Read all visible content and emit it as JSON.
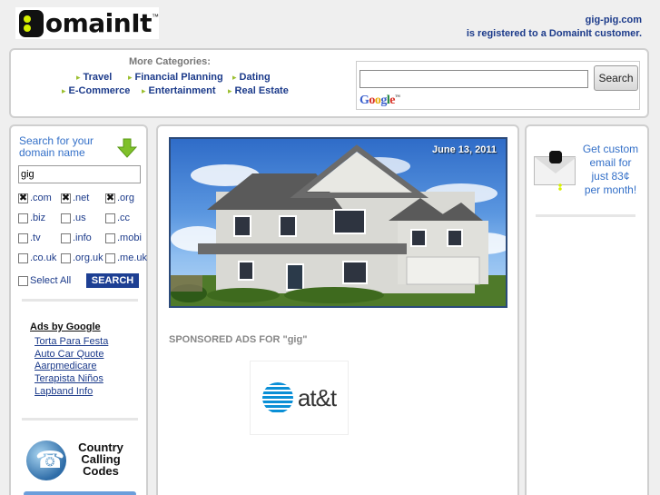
{
  "header": {
    "logo_text": "omainIt",
    "logo_tm": "™",
    "domain": "gig-pig.com",
    "registered_text": "is registered to a DomainIt customer."
  },
  "categories": {
    "title": "More Categories:",
    "items": [
      {
        "label": "Travel"
      },
      {
        "label": "Financial Planning"
      },
      {
        "label": "Dating"
      },
      {
        "label": "E-Commerce"
      },
      {
        "label": "Entertainment"
      },
      {
        "label": "Real Estate"
      }
    ],
    "accent_color": "#9bbf2e"
  },
  "google_search": {
    "value": "",
    "button_label": "Search",
    "brand": [
      "G",
      "o",
      "o",
      "g",
      "l",
      "e"
    ],
    "tm": "™"
  },
  "domain_search": {
    "title": "Search for your domain name",
    "input_value": "gig",
    "tlds": [
      {
        "label": ".com",
        "checked": true
      },
      {
        "label": ".net",
        "checked": true
      },
      {
        "label": ".org",
        "checked": true
      },
      {
        "label": ".biz",
        "checked": false
      },
      {
        "label": ".us",
        "checked": false
      },
      {
        "label": ".cc",
        "checked": false
      },
      {
        "label": ".tv",
        "checked": false
      },
      {
        "label": ".info",
        "checked": false
      },
      {
        "label": ".mobi",
        "checked": false
      },
      {
        "label": ".co.uk",
        "checked": false
      },
      {
        "label": ".org.uk",
        "checked": false
      },
      {
        "label": ".me.uk",
        "checked": false
      }
    ],
    "select_all_label": "Select All",
    "search_label": "SEARCH",
    "button_color": "#1d3f93"
  },
  "ads": {
    "title": "Ads by Google",
    "links": [
      "Torta Para Festa",
      "Auto Car Quote",
      "Aarpmedicare",
      "Terapista Niños",
      "Lapband Info"
    ]
  },
  "calling_codes": {
    "label_line1": "Country",
    "label_line2": "Calling",
    "label_line3": "Codes"
  },
  "main": {
    "date": "June 13, 2011",
    "sponsored_label": "SPONSORED ADS FOR \"gig\"",
    "sponsor_brand": "at&t"
  },
  "promo": {
    "line1": "Get custom",
    "line2": "email for",
    "line3": "just 83¢",
    "line4": "per month!"
  }
}
